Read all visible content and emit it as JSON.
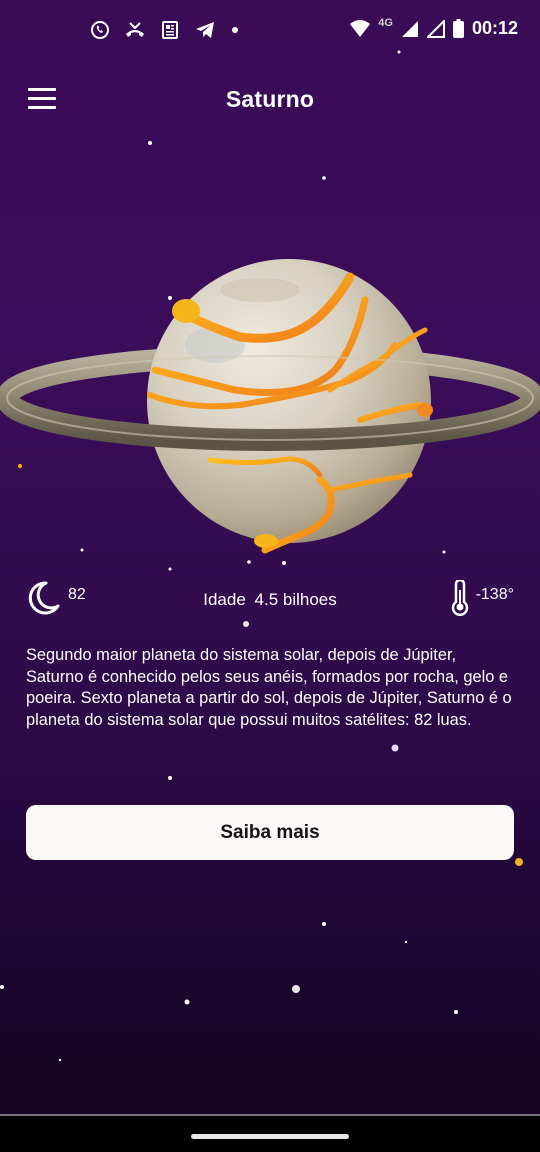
{
  "status_bar": {
    "time": "00:12",
    "network": "4G",
    "notification_icons": [
      "whatsapp-icon",
      "missed-call-icon",
      "news-icon",
      "telegram-icon",
      "dot-icon"
    ],
    "system_icons": [
      "wifi-icon",
      "signal-icon",
      "signal-icon",
      "battery-icon"
    ]
  },
  "app_bar": {
    "title": "Saturno",
    "menu_icon": "hamburger-menu-icon"
  },
  "planet": {
    "name": "Saturno",
    "colors": {
      "body": "#d7cfc0",
      "ring": "#8f8773",
      "lava": "#f5a90e"
    }
  },
  "stats": {
    "moons": {
      "icon": "moon-icon",
      "value": "82"
    },
    "age": {
      "label": "Idade",
      "value": "4.5 bilhoes"
    },
    "temperature": {
      "icon": "thermometer-icon",
      "value": "-138°"
    }
  },
  "description": "Segundo maior planeta do sistema solar, depois de Júpiter, Saturno é conhecido pelos seus anéis, formados por rocha, gelo e poeira. Sexto planeta a partir do sol, depois de Júpiter, Saturno é o planeta do sistema solar que possui muitos satélites: 82 luas.",
  "cta": {
    "label": "Saiba mais"
  },
  "colors": {
    "background_top": "#3a0c56",
    "background_bottom": "#12041f",
    "button_bg": "#fcf8f8"
  }
}
